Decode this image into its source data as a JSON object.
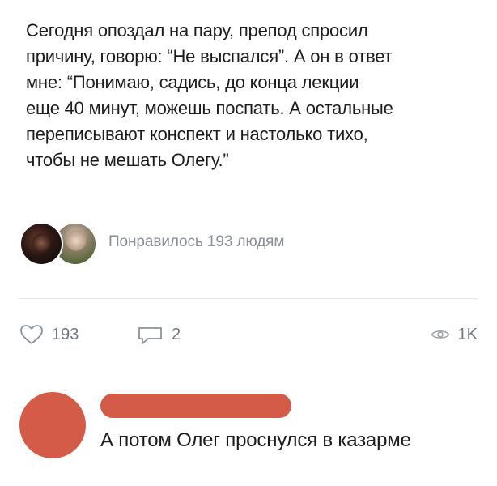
{
  "post": {
    "text_lines": [
      "Сегодня опоздал на пару, препод спросил",
      "причину, говорю: “Не выспался”. А он в ответ",
      "мне: “Понимаю, садись, до конца лекции",
      "еще 40 минут, можешь поспать. А остальные",
      "переписывают конспект и настолько тихо,",
      "чтобы не мешать Олегу.”"
    ],
    "likes_summary": "Понравилось 193 людям"
  },
  "actions": {
    "likes_count": "193",
    "comments_count": "2",
    "views_count": "1K",
    "icons": {
      "like": "heart-icon",
      "comment": "comment-bubble-icon",
      "views": "eye-icon"
    }
  },
  "comment": {
    "text": "А потом Олег проснулся в казарме",
    "avatar_color": "#d45b47",
    "redaction_color": "#d45b47"
  },
  "colors": {
    "text": "#1c1c1c",
    "muted": "#8a8f96",
    "divider": "#e4e6e9",
    "accent_red": "#d45b47"
  }
}
